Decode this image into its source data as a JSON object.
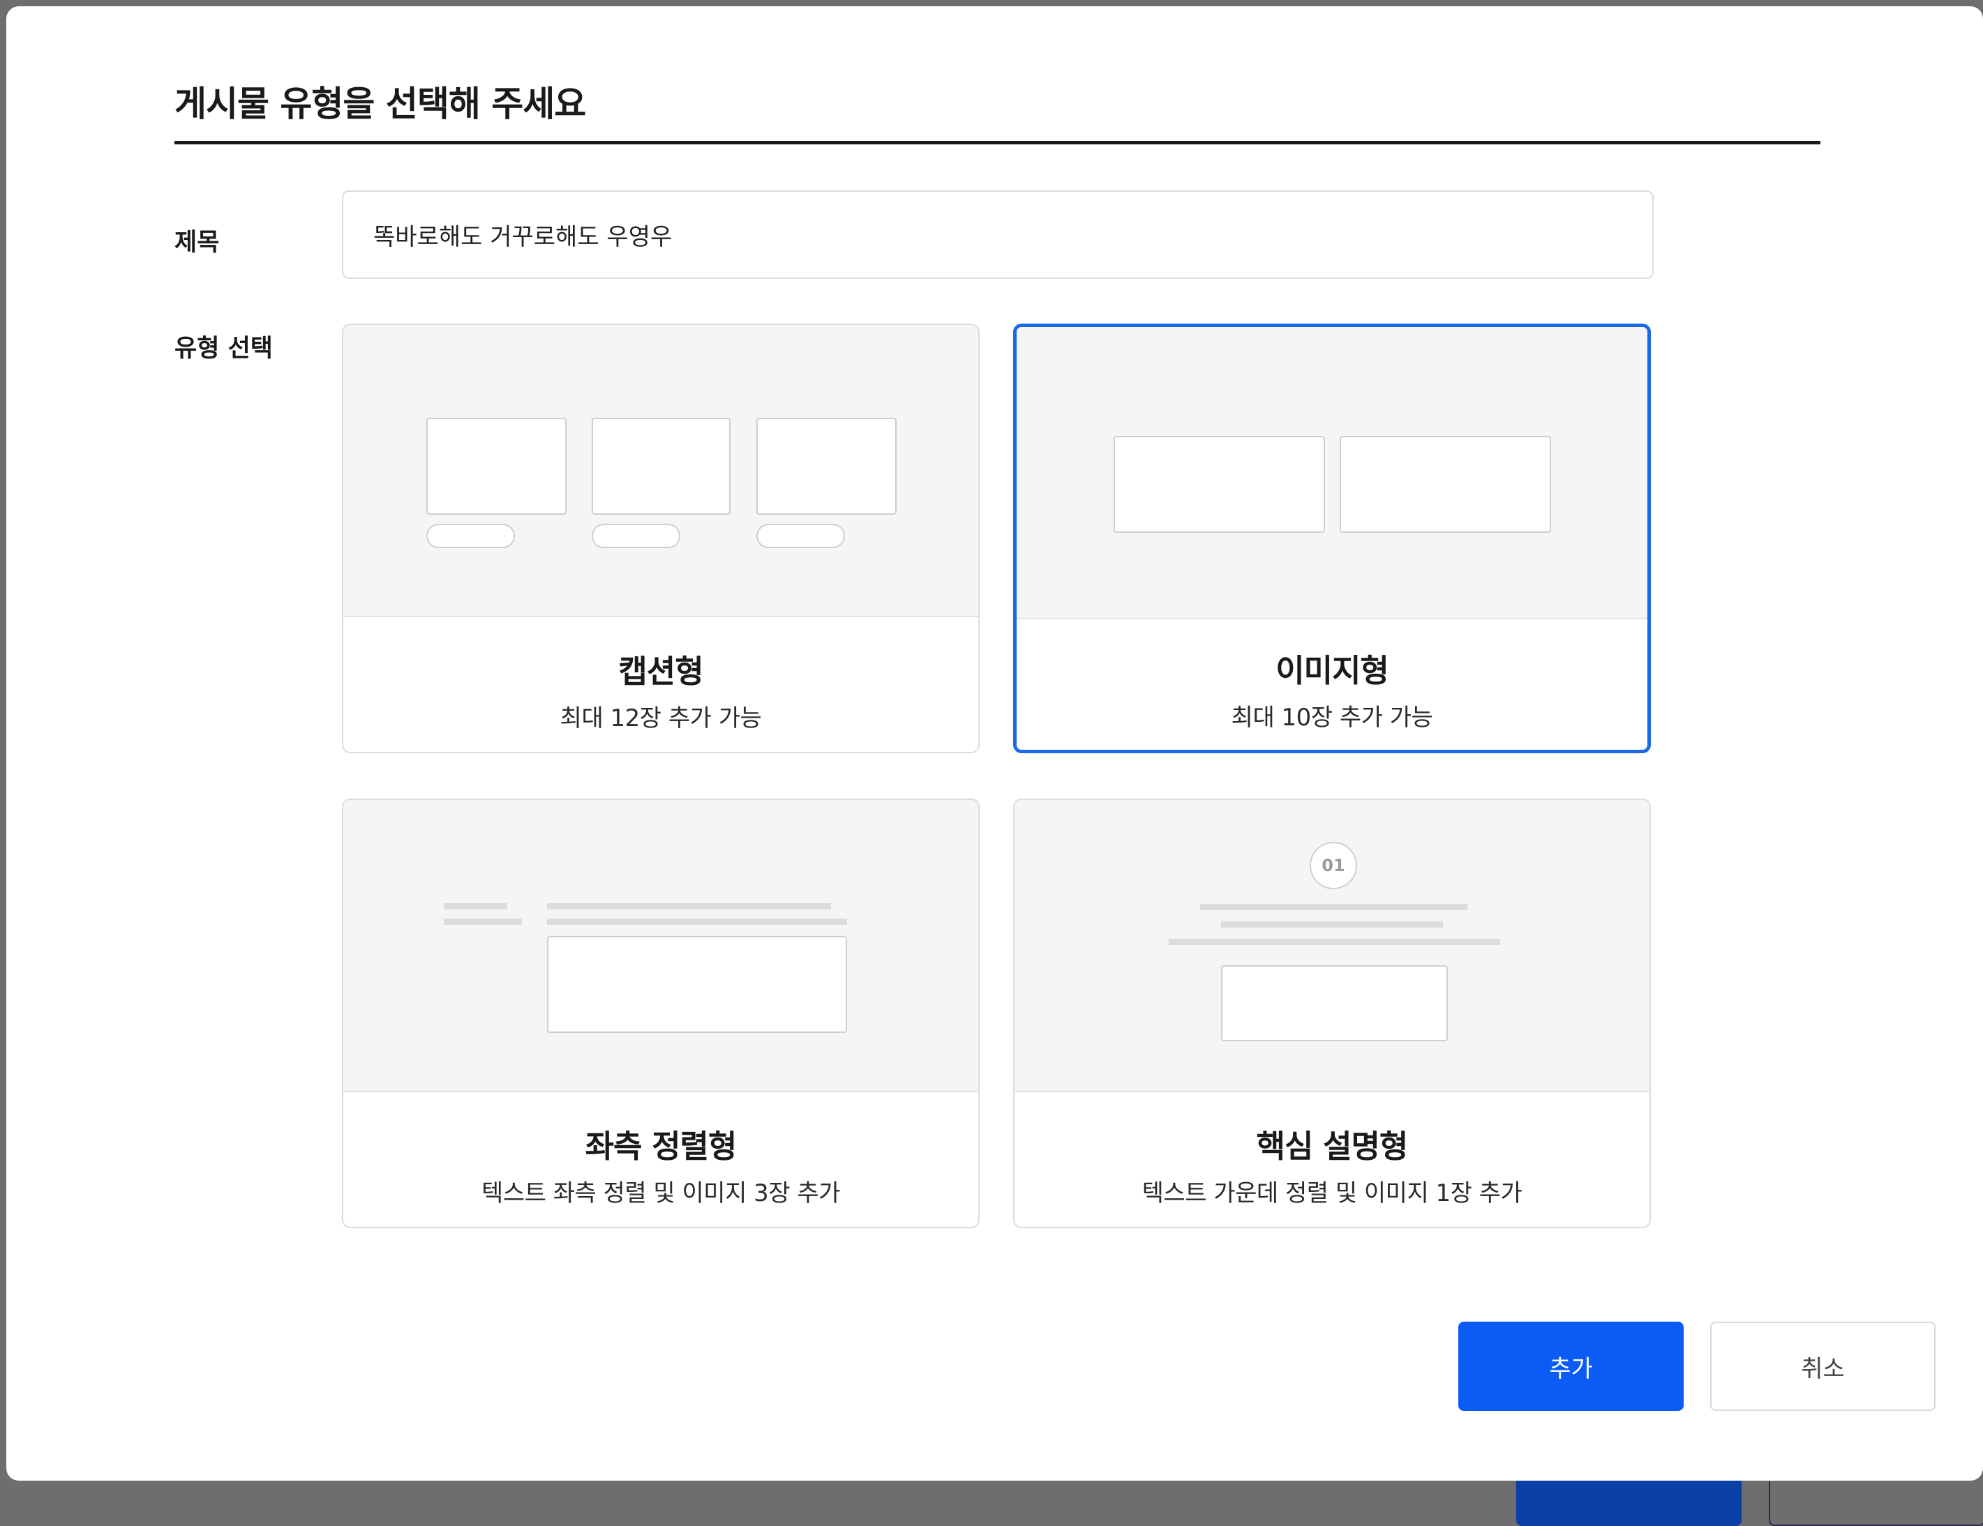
{
  "modal": {
    "title": "게시물 유형을 선택해 주세요"
  },
  "form": {
    "title_label": "제목",
    "title_value": "똑바로해도 거꾸로해도 우영우",
    "type_label": "유형 선택"
  },
  "types": [
    {
      "name": "캡션형",
      "description": "최대 12장 추가 가능",
      "selected": false
    },
    {
      "name": "이미지형",
      "description": "최대 10장 추가 가능",
      "selected": true
    },
    {
      "name": "좌측 정렬형",
      "description": "텍스트 좌측 정렬 및 이미지 3장 추가",
      "selected": false
    },
    {
      "name": "핵심 설명형",
      "description": "텍스트 가운데 정렬 및 이미지 1장 추가",
      "selected": false,
      "badge": "01"
    }
  ],
  "actions": {
    "add_label": "추가",
    "cancel_label": "취소"
  },
  "colors": {
    "accent": "#0a5cf5",
    "selected_border": "#1a6ae8",
    "preview_bg": "#f5f5f5"
  }
}
